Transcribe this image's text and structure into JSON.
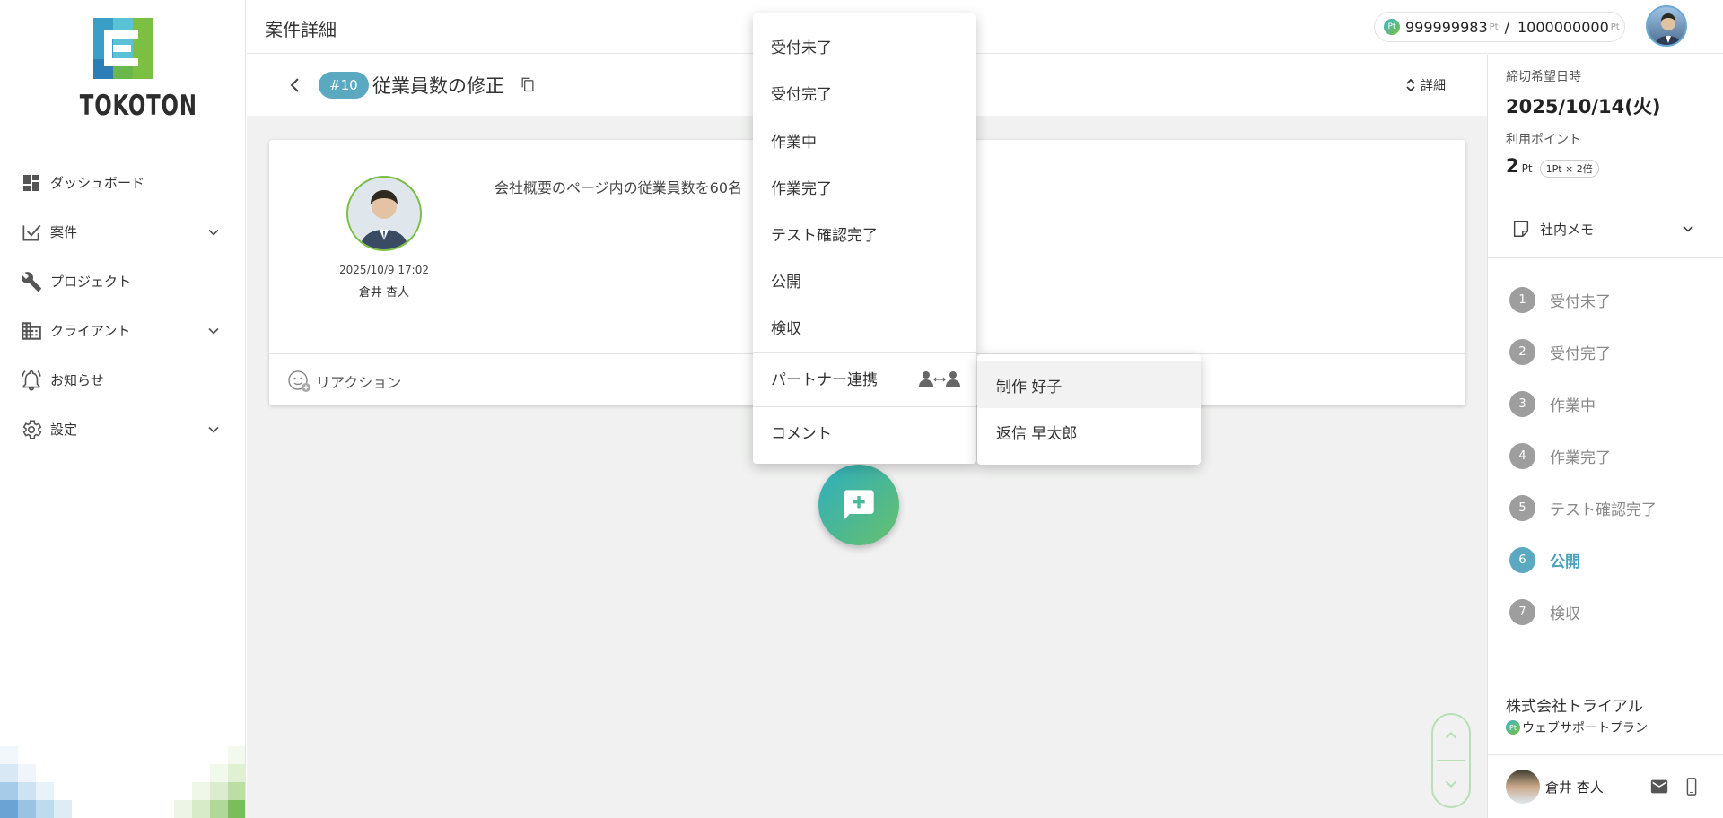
{
  "brand": {
    "name": "TOKOTON"
  },
  "sidebar": {
    "items": [
      {
        "label": "ダッシュボード",
        "icon": "dashboard-icon",
        "expandable": false
      },
      {
        "label": "案件",
        "icon": "case-check-icon",
        "expandable": true
      },
      {
        "label": "プロジェクト",
        "icon": "tools-icon",
        "expandable": false
      },
      {
        "label": "クライアント",
        "icon": "building-icon",
        "expandable": true
      },
      {
        "label": "お知らせ",
        "icon": "bell-icon",
        "expandable": false
      },
      {
        "label": "設定",
        "icon": "gear-icon",
        "expandable": true
      }
    ]
  },
  "header": {
    "title": "案件詳細",
    "points": {
      "badge": "Pt",
      "used": "999999983",
      "unit": "Pt",
      "separator": "/",
      "total": "1000000000"
    }
  },
  "case": {
    "number": "#10",
    "title": "従業員数の修正",
    "detail_label": "詳細"
  },
  "post": {
    "date": "2025/10/9 17:02",
    "author": "倉井 杏人",
    "text": "会社概要のページ内の従業員数を60名",
    "reaction_label": "リアクション"
  },
  "menu": {
    "items": [
      {
        "label": "受付未了"
      },
      {
        "label": "受付完了"
      },
      {
        "label": "作業中"
      },
      {
        "label": "作業完了"
      },
      {
        "label": "テスト確認完了"
      },
      {
        "label": "公開"
      },
      {
        "label": "検収"
      }
    ],
    "partner_label": "パートナー連携",
    "comment_label": "コメント"
  },
  "submenu": {
    "items": [
      {
        "label": "制作 好子",
        "highlighted": true
      },
      {
        "label": "返信 早太郎",
        "highlighted": false
      }
    ]
  },
  "right_panel": {
    "deadline_label": "締切希望日時",
    "deadline": "2025/10/14(火)",
    "points_label": "利用ポイント",
    "points_value": "2",
    "points_unit": "Pt",
    "points_calc": "1Pt × 2倍",
    "memo_label": "社内メモ",
    "steps": [
      {
        "num": "1",
        "label": "受付未了"
      },
      {
        "num": "2",
        "label": "受付完了"
      },
      {
        "num": "3",
        "label": "作業中"
      },
      {
        "num": "4",
        "label": "作業完了"
      },
      {
        "num": "5",
        "label": "テスト確認完了"
      },
      {
        "num": "6",
        "label": "公開"
      },
      {
        "num": "7",
        "label": "検収"
      }
    ],
    "active_step": "6",
    "company": "株式会社トライアル",
    "plan_badge": "Pt",
    "plan": "ウェブサポートプラン",
    "user_name": "倉井 杏人"
  },
  "colors": {
    "accent": "#5aa9c1",
    "brand_green": "#7bc043",
    "brand_blue": "#3bb5c9",
    "step_inactive": "#9e9e9e",
    "bg": "#f0f1f0"
  }
}
